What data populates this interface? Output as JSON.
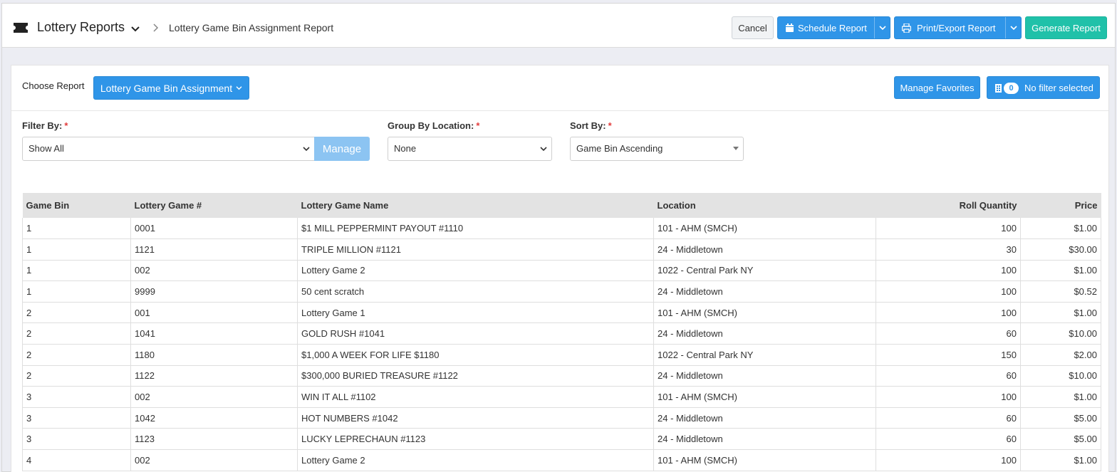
{
  "header": {
    "title": "Lottery Reports",
    "breadcrumb_current": "Lottery Game Bin Assignment Report",
    "buttons": {
      "cancel": "Cancel",
      "schedule": "Schedule Report",
      "print_export": "Print/Export Report",
      "generate": "Generate Report"
    }
  },
  "controls": {
    "choose_report_label": "Choose Report",
    "choose_report_value": "Lottery Game Bin Assignment",
    "manage_favorites": "Manage Favorites",
    "filter_count": "0",
    "filter_status": "No filter selected",
    "filter_by": {
      "label": "Filter By:",
      "value": "Show All",
      "manage": "Manage"
    },
    "group_by": {
      "label": "Group By Location:",
      "value": "None"
    },
    "sort_by": {
      "label": "Sort By:",
      "value": "Game Bin Ascending"
    },
    "required_mark": "*"
  },
  "table": {
    "columns": [
      "Game Bin",
      "Lottery Game #",
      "Lottery Game Name",
      "Location",
      "Roll Quantity",
      "Price"
    ],
    "rows": [
      [
        "1",
        "0001",
        "$1 MILL PEPPERMINT PAYOUT #1110",
        "101 - AHM (SMCH)",
        "100",
        "$1.00"
      ],
      [
        "1",
        "1121",
        "TRIPLE MILLION #1121",
        "24 - Middletown",
        "30",
        "$30.00"
      ],
      [
        "1",
        "002",
        "Lottery Game 2",
        "1022 - Central Park NY",
        "100",
        "$1.00"
      ],
      [
        "1",
        "9999",
        "50 cent scratch",
        "24 - Middletown",
        "100",
        "$0.52"
      ],
      [
        "2",
        "001",
        "Lottery Game 1",
        "101 - AHM (SMCH)",
        "100",
        "$1.00"
      ],
      [
        "2",
        "1041",
        "GOLD RUSH #1041",
        "24 - Middletown",
        "60",
        "$10.00"
      ],
      [
        "2",
        "1180",
        "$1,000 A WEEK FOR LIFE $1180",
        "1022 - Central Park NY",
        "150",
        "$2.00"
      ],
      [
        "2",
        "1122",
        "$300,000 BURIED TREASURE #1122",
        "24 - Middletown",
        "60",
        "$10.00"
      ],
      [
        "3",
        "002",
        "WIN IT ALL #1102",
        "101 - AHM (SMCH)",
        "100",
        "$1.00"
      ],
      [
        "3",
        "1042",
        "HOT NUMBERS #1042",
        "24 - Middletown",
        "60",
        "$5.00"
      ],
      [
        "3",
        "1123",
        "LUCKY LEPRECHAUN #1123",
        "24 - Middletown",
        "60",
        "$5.00"
      ],
      [
        "4",
        "002",
        "Lottery Game 2",
        "101 - AHM (SMCH)",
        "100",
        "$1.00"
      ]
    ]
  },
  "colors": {
    "primary": "#2f95e8",
    "teal": "#20c1a9",
    "manage_disabled": "#8cc4f2",
    "required": "#e23b3b"
  },
  "icons": [
    "ticket-icon",
    "chevron-down-icon",
    "chevron-right-icon",
    "calendar-icon",
    "printer-icon",
    "filter-icon"
  ]
}
